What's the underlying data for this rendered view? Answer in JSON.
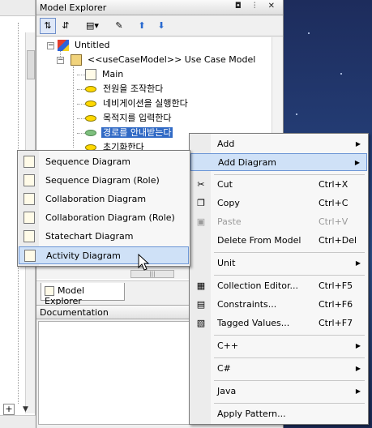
{
  "explorer": {
    "title": "Model Explorer",
    "title_buttons": "◘ ⫶ ✕",
    "tree": {
      "root": "Untitled",
      "model": "<<useCaseModel>> Use Case Model",
      "items": [
        "Main",
        "전원을 조작한다",
        "네비게이션을 실행한다",
        "목적지를 입력한다",
        "경로를 안내받는다",
        "초기화한다"
      ],
      "selected_index": 4
    },
    "tab_label": "Model Explorer",
    "doc_label": "Documentation"
  },
  "context_menu": {
    "items": [
      {
        "label": "Add",
        "shortcut": "",
        "submenu": true
      },
      {
        "label": "Add Diagram",
        "shortcut": "",
        "submenu": true,
        "highlighted": true
      },
      {
        "label": "Cut",
        "shortcut": "Ctrl+X"
      },
      {
        "label": "Copy",
        "shortcut": "Ctrl+C"
      },
      {
        "label": "Paste",
        "shortcut": "Ctrl+V",
        "disabled": true
      },
      {
        "label": "Delete From Model",
        "shortcut": "Ctrl+Del"
      },
      {
        "label": "Unit",
        "shortcut": "",
        "submenu": true
      },
      {
        "label": "Collection Editor...",
        "shortcut": "Ctrl+F5"
      },
      {
        "label": "Constraints...",
        "shortcut": "Ctrl+F6"
      },
      {
        "label": "Tagged Values...",
        "shortcut": "Ctrl+F7"
      },
      {
        "label": "C++",
        "shortcut": "",
        "submenu": true
      },
      {
        "label": "C#",
        "shortcut": "",
        "submenu": true
      },
      {
        "label": "Java",
        "shortcut": "",
        "submenu": true
      },
      {
        "label": "Apply Pattern...",
        "shortcut": ""
      }
    ]
  },
  "diagram_submenu": {
    "items": [
      "Sequence Diagram",
      "Sequence Diagram (Role)",
      "Collaboration Diagram",
      "Collaboration Diagram (Role)",
      "Statechart Diagram",
      "Activity Diagram"
    ],
    "highlighted_index": 5
  },
  "colors": {
    "selection": "#316ac5",
    "menu_highlight": "#cfe1f7",
    "usecase": "#ffd800"
  }
}
